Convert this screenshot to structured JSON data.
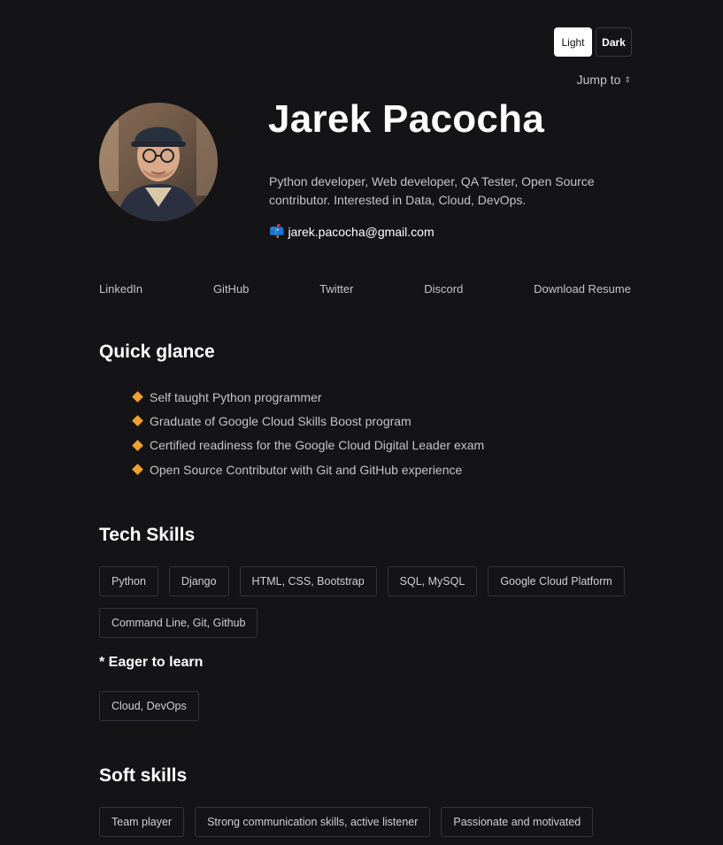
{
  "theme": {
    "light_label": "Light",
    "dark_label": "Dark"
  },
  "nav": {
    "jump_label": "Jump to",
    "jump_arrows": "⇕"
  },
  "profile": {
    "name": "Jarek Pacocha",
    "bio": "Python developer, Web developer, QA Tester, Open Source contributor. Interested in Data, Cloud, DevOps.",
    "email_icon": "📫",
    "email": "jarek.pacocha@gmail.com"
  },
  "links": [
    "LinkedIn",
    "GitHub",
    "Twitter",
    "Discord",
    "Download Resume"
  ],
  "quick_glance": {
    "title": "Quick glance",
    "items": [
      "Self taught Python programmer",
      "Graduate of Google Cloud Skills Boost program",
      "Certified readiness for the Google Cloud Digital Leader exam",
      "Open Source Contributor with Git and GitHub experience"
    ]
  },
  "tech_skills": {
    "title": "Tech Skills",
    "items": [
      "Python",
      "Django",
      "HTML, CSS, Bootstrap",
      "SQL, MySQL",
      "Google Cloud Platform",
      "Command Line, Git, Github"
    ],
    "eager_title": "* Eager to learn",
    "eager_items": [
      "Cloud, DevOps"
    ]
  },
  "soft_skills": {
    "title": "Soft skills",
    "items": [
      "Team player",
      "Strong communication skills, active listener",
      "Passionate and motivated"
    ]
  },
  "colors": {
    "background": "#141417",
    "text": "#d4d4d4",
    "accent_diamond": "#f0a030"
  }
}
